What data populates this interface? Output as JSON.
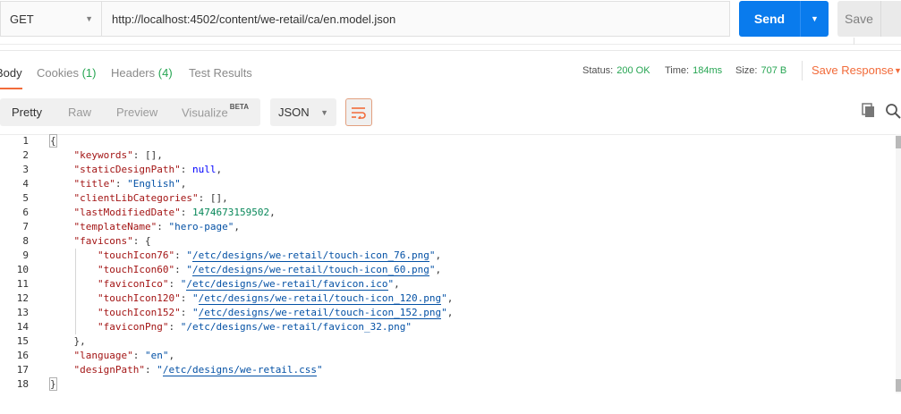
{
  "request": {
    "method": "GET",
    "url": "http://localhost:4502/content/we-retail/ca/en.model.json",
    "send_label": "Send",
    "save_label": "Save"
  },
  "response_tabs": {
    "body": "Body",
    "cookies": "Cookies",
    "cookies_count": "(1)",
    "headers": "Headers",
    "headers_count": "(4)",
    "tests": "Test Results"
  },
  "status": {
    "status_label": "Status:",
    "status_value": "200 OK",
    "time_label": "Time:",
    "time_value": "184ms",
    "size_label": "Size:",
    "size_value": "707 B",
    "save_response": "Save Response"
  },
  "format": {
    "pretty": "Pretty",
    "raw": "Raw",
    "preview": "Preview",
    "visualize": "Visualize",
    "visualize_badge": "BETA",
    "language": "JSON"
  },
  "code": {
    "line_numbers": [
      "1",
      "2",
      "3",
      "4",
      "5",
      "6",
      "7",
      "8",
      "9",
      "10",
      "11",
      "12",
      "13",
      "14",
      "15",
      "16",
      "17",
      "18"
    ],
    "keywords_key": "\"keywords\"",
    "static_key": "\"staticDesignPath\"",
    "title_key": "\"title\"",
    "title_val": "\"English\"",
    "clientlib_key": "\"clientLibCategories\"",
    "lastmod_key": "\"lastModifiedDate\"",
    "lastmod_val": "1474673159502",
    "template_key": "\"templateName\"",
    "template_val": "\"hero-page\"",
    "favicons_key": "\"favicons\"",
    "ti76_key": "\"touchIcon76\"",
    "ti76_val": "/etc/designs/we-retail/touch-icon_76.png",
    "ti60_key": "\"touchIcon60\"",
    "ti60_val": "/etc/designs/we-retail/touch-icon_60.png",
    "fico_key": "\"faviconIco\"",
    "fico_val": "/etc/designs/we-retail/favicon.ico",
    "ti120_key": "\"touchIcon120\"",
    "ti120_val": "/etc/designs/we-retail/touch-icon_120.png",
    "ti152_key": "\"touchIcon152\"",
    "ti152_val": "/etc/designs/we-retail/touch-icon_152.png",
    "fpng_key": "\"faviconPng\"",
    "fpng_val": "\"/etc/designs/we-retail/favicon_32.png\"",
    "language_key": "\"language\"",
    "language_val": "\"en\"",
    "design_key": "\"designPath\"",
    "design_val": "/etc/designs/we-retail.css",
    "null_literal": "null",
    "empty_array": "[]"
  },
  "colors": {
    "accent": "#f26b3a",
    "send": "#097bed",
    "status_green": "#26a552"
  }
}
